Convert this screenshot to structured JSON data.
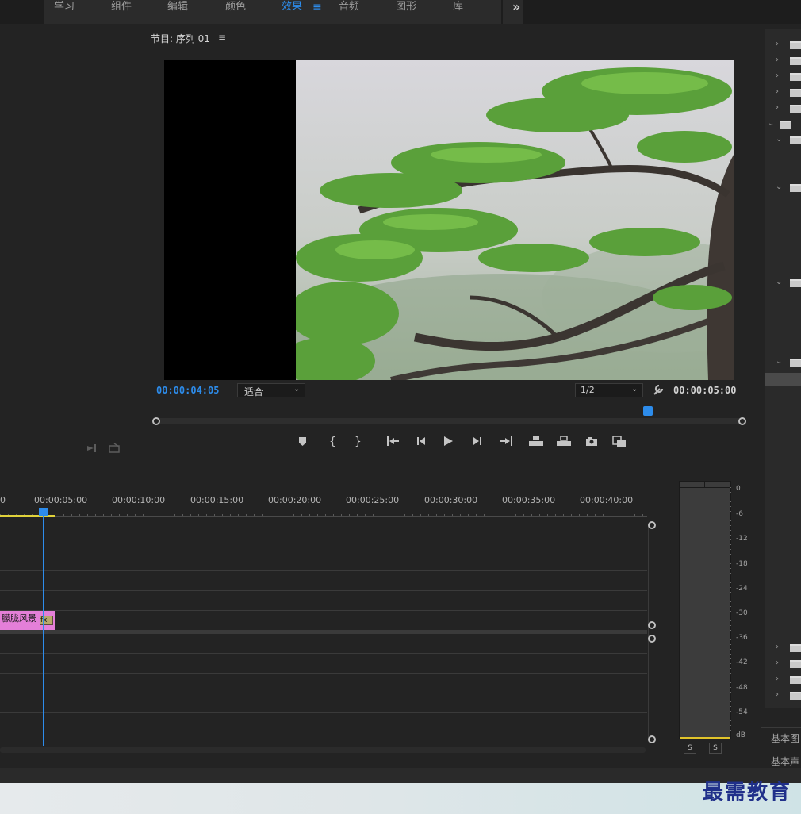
{
  "workspace_tabs": [
    {
      "label": "学习",
      "active": false
    },
    {
      "label": "组件",
      "active": false
    },
    {
      "label": "编辑",
      "active": false
    },
    {
      "label": "颜色",
      "active": false
    },
    {
      "label": "效果",
      "active": true
    },
    {
      "label": "音频",
      "active": false
    },
    {
      "label": "图形",
      "active": false
    },
    {
      "label": "库",
      "active": false
    }
  ],
  "tabs_menu_glyph": "≡",
  "tabs_overflow_glyph": "»",
  "program": {
    "title": "节目: 序列 01",
    "menu_glyph": "≡",
    "current_timecode": "00:00:04:05",
    "fit_label": "适合",
    "resolution_label": "1/2",
    "duration_timecode": "00:00:05:00",
    "playhead_fraction": 0.835
  },
  "transport_icons": [
    "marker-icon",
    "mark-in-icon",
    "mark-out-icon",
    "go-to-in-icon",
    "step-back-icon",
    "play-icon",
    "step-forward-icon",
    "go-to-out-icon",
    "lift-icon",
    "extract-icon",
    "export-frame-icon",
    "compare-icon",
    "add-button-icon"
  ],
  "timeline": {
    "ruler_labels": [
      "00:00:05:00",
      "00:00:10:00",
      "00:00:15:00",
      "00:00:20:00",
      "00:00:25:00",
      "00:00:30:00",
      "00:00:35:00",
      "00:00:40:00"
    ],
    "ruler_start_label": "0",
    "clip_label": "朦胧风景",
    "clip_fx": "fx"
  },
  "audio_meter": {
    "scale": [
      "0",
      "-6",
      "-12",
      "-18",
      "-24",
      "-30",
      "-36",
      "-42",
      "-48",
      "-54",
      "dB"
    ],
    "solo_buttons": [
      "S",
      "S"
    ]
  },
  "right_panel": {
    "bottom_labels": [
      "基本图",
      "基本声"
    ]
  },
  "watermark": "最需教育",
  "colors": {
    "accent_blue": "#2d8ceb",
    "clip_pink": "#e47fd8",
    "panel_bg": "#232323",
    "video_sky": "#dcdce0",
    "foliage": "#5fa83a"
  }
}
